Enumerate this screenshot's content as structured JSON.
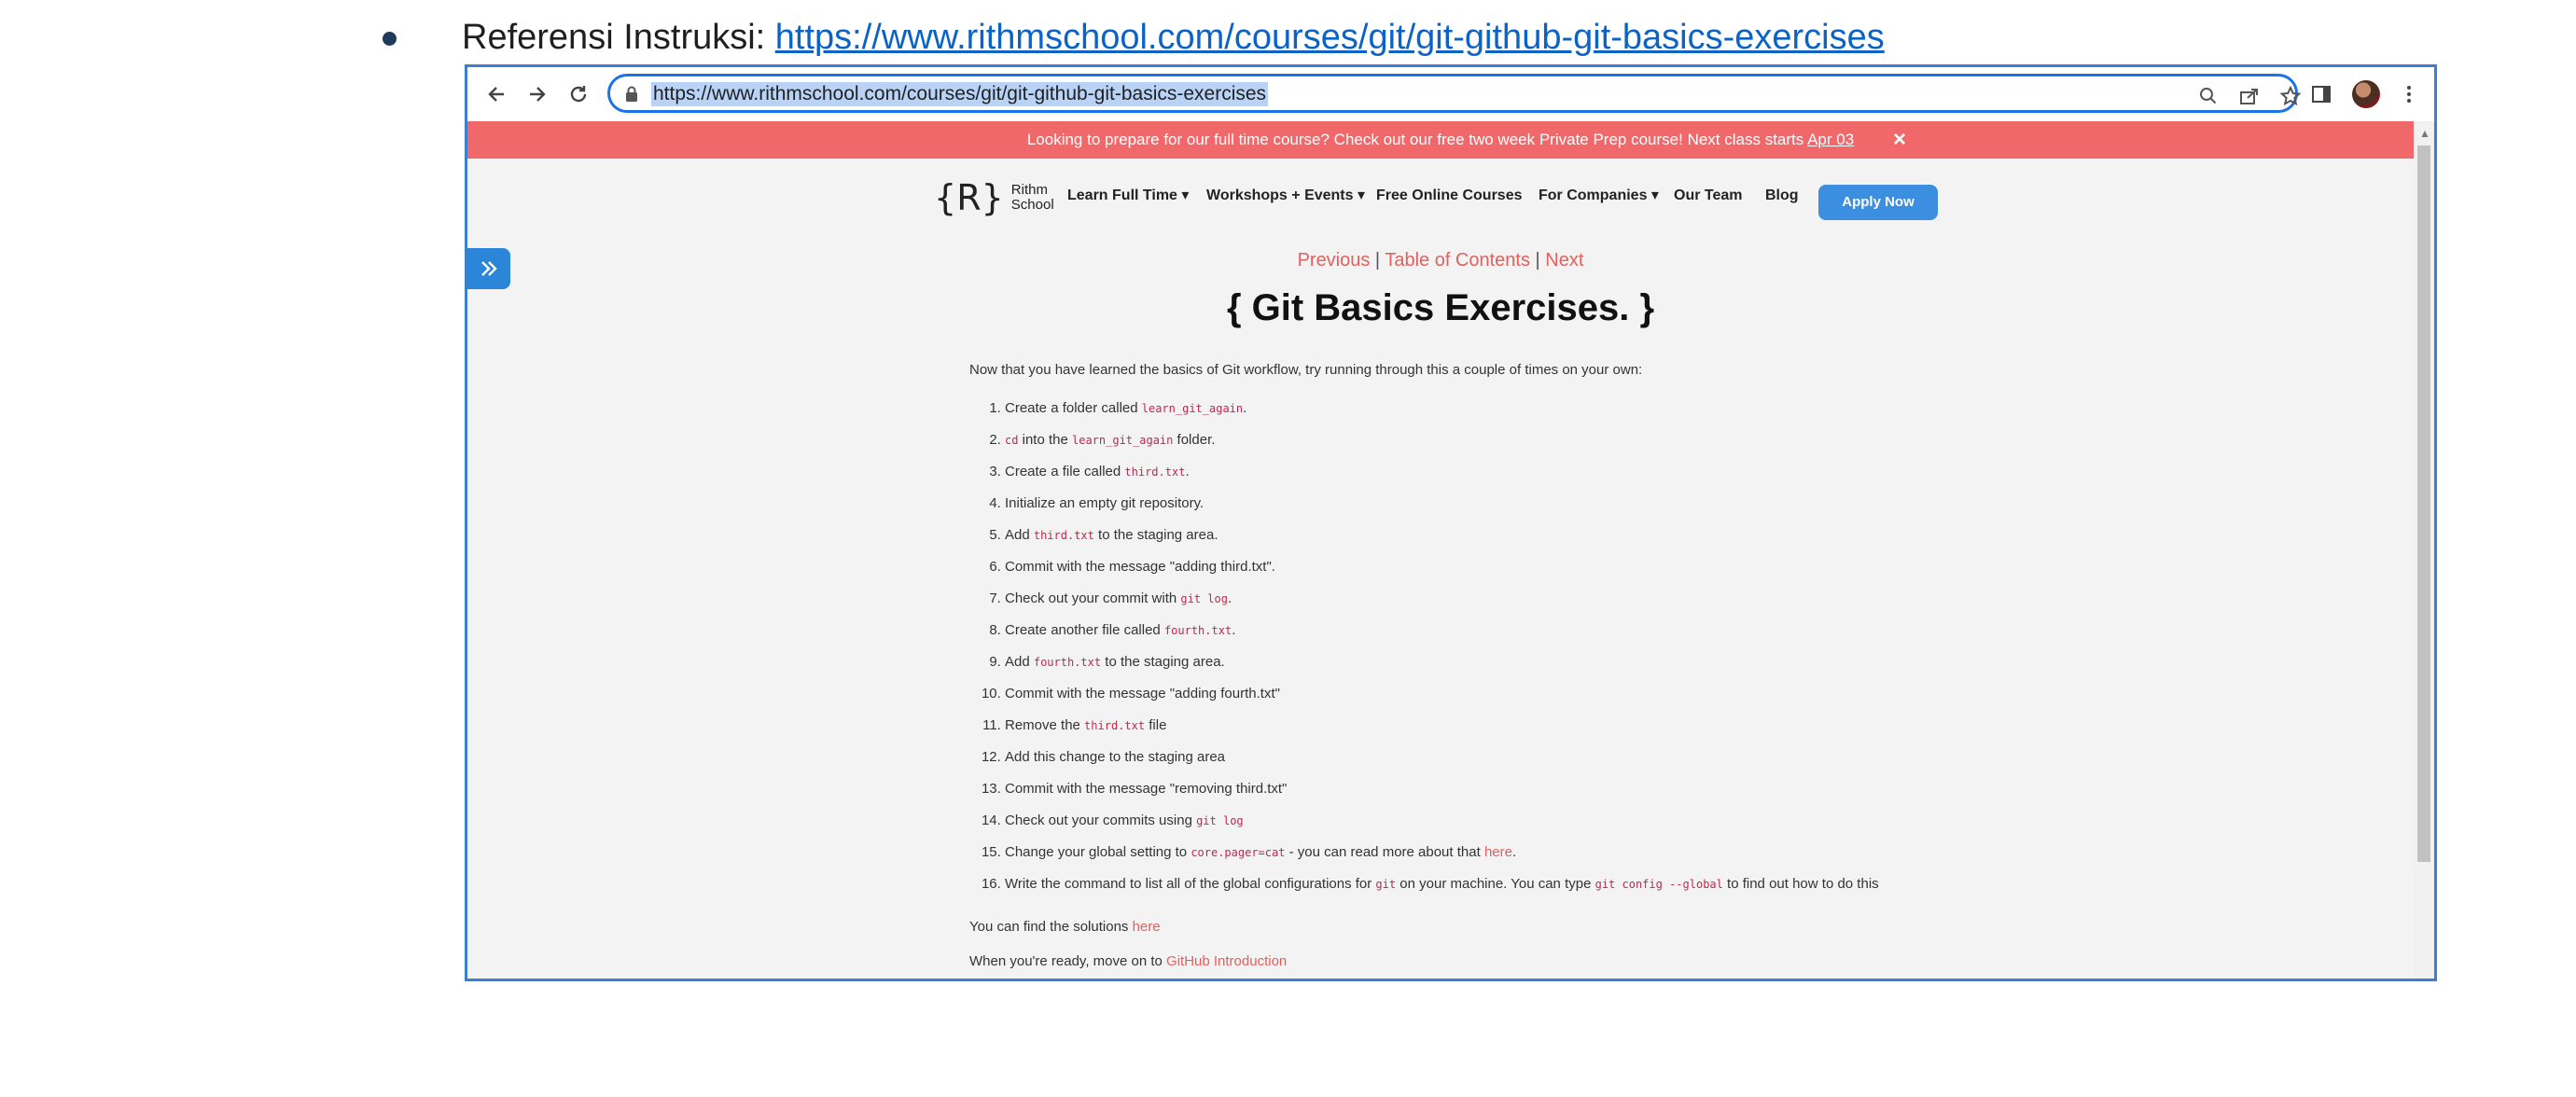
{
  "doc": {
    "label": "Referensi Instruksi: ",
    "link": "https://www.rithmschool.com/courses/git/git-github-git-basics-exercises"
  },
  "browser": {
    "url": "https://www.rithmschool.com/courses/git/git-github-git-basics-exercises",
    "icons": [
      "back-icon",
      "forward-icon",
      "reload-icon",
      "lock-icon",
      "zoom-icon",
      "share-icon",
      "bookmark-star-icon",
      "side-panel-icon",
      "profile-avatar",
      "menu-kebab-icon"
    ]
  },
  "banner": {
    "text": "Looking to prepare for our full time course? Check out our free two week Private Prep course! Next class starts ",
    "link": "Apr 03",
    "close": "×"
  },
  "site": {
    "logo_r": "R",
    "logo_line1": "Rithm",
    "logo_line2": "School",
    "nav": {
      "learn": "Learn Full Time ▾",
      "workshops": "Workshops + Events ▾",
      "free": "Free Online Courses",
      "companies": "For Companies ▾",
      "team": "Our Team",
      "blog": "Blog",
      "apply": "Apply Now"
    }
  },
  "pager": {
    "previous": "Previous",
    "sep": " | ",
    "toc": "Table of Contents",
    "next": "Next"
  },
  "page": {
    "title": "{ Git Basics Exercises. }",
    "intro": "Now that you have learned the basics of Git workflow, try running through this a couple of times on your own:",
    "steps": [
      {
        "pre": "Create a folder called ",
        "code": "learn_git_again",
        "post": "."
      },
      {
        "pre": "",
        "code": "cd",
        "mid": " into the ",
        "code2": "learn_git_again",
        "post": " folder."
      },
      {
        "pre": "Create a file called ",
        "code": "third.txt",
        "post": "."
      },
      {
        "pre": "Initialize an empty git repository.",
        "code": "",
        "post": ""
      },
      {
        "pre": "Add ",
        "code": "third.txt",
        "post": " to the staging area."
      },
      {
        "pre": "Commit with the message \"adding third.txt\".",
        "code": "",
        "post": ""
      },
      {
        "pre": "Check out your commit with ",
        "code": "git log",
        "post": "."
      },
      {
        "pre": "Create another file called ",
        "code": "fourth.txt",
        "post": "."
      },
      {
        "pre": "Add ",
        "code": "fourth.txt",
        "post": " to the staging area."
      },
      {
        "pre": "Commit with the message \"adding fourth.txt\"",
        "code": "",
        "post": ""
      },
      {
        "pre": "Remove the ",
        "code": "third.txt",
        "post": " file"
      },
      {
        "pre": "Add this change to the staging area",
        "code": "",
        "post": ""
      },
      {
        "pre": "Commit with the message \"removing third.txt\"",
        "code": "",
        "post": ""
      },
      {
        "pre": "Check out your commits using ",
        "code": "git log",
        "post": ""
      },
      {
        "pre": "Change your global setting to ",
        "code": "core.pager=cat",
        "post": " - you can read more about that ",
        "link": "here",
        "tail": "."
      },
      {
        "pre": "Write the command to list all of the global configurations for ",
        "code": "git",
        "mid": " on your machine. You can type ",
        "code2": "git config --global",
        "post": " to find out how to do this"
      }
    ],
    "solutions_text": "You can find the solutions ",
    "solutions_link": "here",
    "ready_text": "When you're ready, move on to ",
    "ready_link": "GitHub Introduction"
  }
}
